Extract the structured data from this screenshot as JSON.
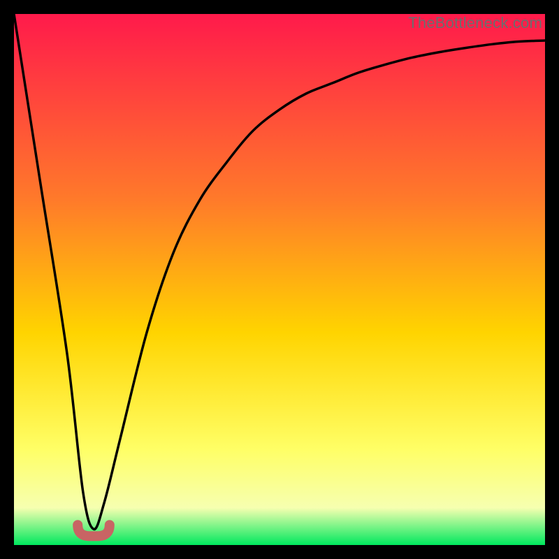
{
  "watermark": "TheBottleneck.com",
  "colors": {
    "gradient_top": "#ff1a4b",
    "gradient_mid1": "#ff7a2a",
    "gradient_mid2": "#ffd400",
    "gradient_mid3": "#ffff66",
    "gradient_mid4": "#f6ffb0",
    "gradient_bottom": "#00e85e",
    "curve": "#000000",
    "marker": "#c86464",
    "frame": "#000000"
  },
  "chart_data": {
    "type": "line",
    "title": "",
    "xlabel": "",
    "ylabel": "",
    "xlim": [
      0,
      100
    ],
    "ylim": [
      0,
      100
    ],
    "grid": false,
    "legend": false,
    "marker": {
      "x_range": [
        12,
        18
      ],
      "y": 3
    },
    "series": [
      {
        "name": "curve",
        "x": [
          0,
          5,
          10,
          13,
          15,
          17,
          20,
          25,
          30,
          35,
          40,
          45,
          50,
          55,
          60,
          65,
          70,
          75,
          80,
          85,
          90,
          95,
          100
        ],
        "y": [
          100,
          68,
          36,
          10,
          3,
          8,
          20,
          40,
          55,
          65,
          72,
          78,
          82,
          85,
          87,
          89,
          90.5,
          91.8,
          92.8,
          93.6,
          94.3,
          94.8,
          95
        ]
      }
    ]
  }
}
